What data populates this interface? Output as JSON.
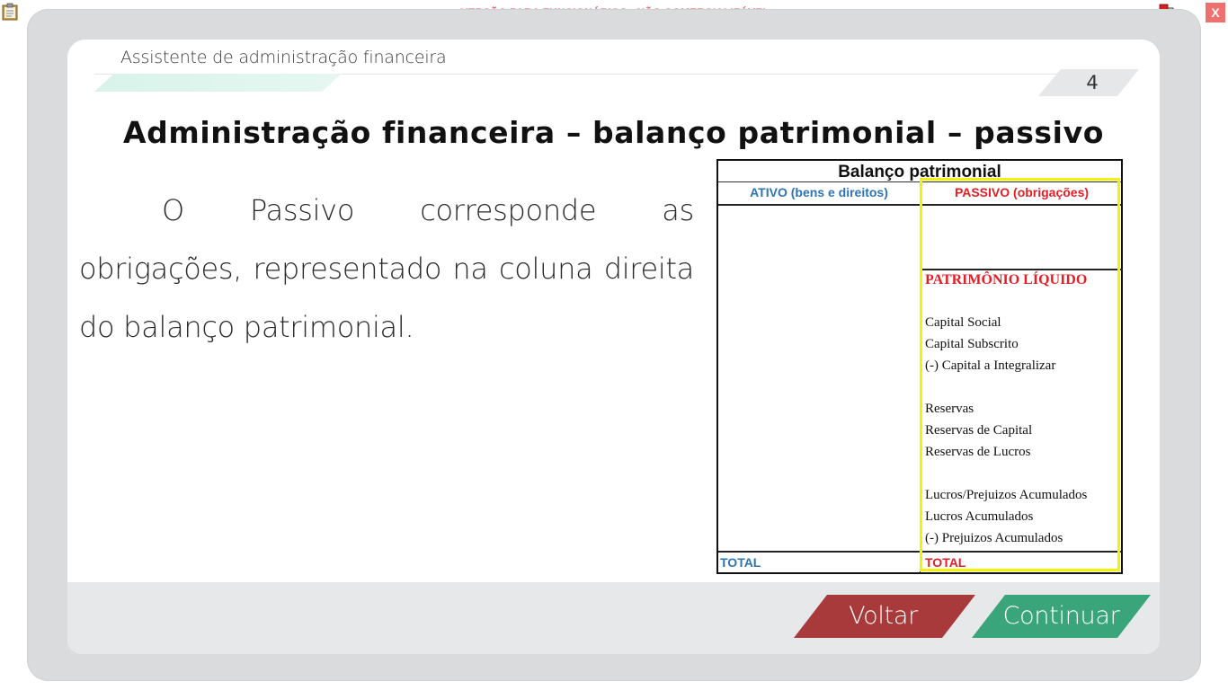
{
  "window": {
    "banner": "VERSÃO PARA FUNCIONÁRIOS - NÃO COMERCIALIZÁVEL",
    "close_label": "X",
    "icons": {
      "clipboard": "clipboard-icon",
      "network": "network-status-icon"
    }
  },
  "header": {
    "course_title": "Assistente de administração financeira",
    "page_number": "4"
  },
  "slide": {
    "title": "Administração financeira – balanço patrimonial – passivo",
    "body": "O Passivo corresponde as obrigações, representado na coluna direita do balanço patrimonial."
  },
  "balance_sheet": {
    "title": "Balanço patrimonial",
    "col_ativo": "ATIVO (bens e direitos)",
    "col_passivo": "PASSIVO (obrigações)",
    "pl_heading": "PATRIMÔNIO LÍQUIDO",
    "items": [
      "Capital Social",
      "Capital Subscrito",
      "(-) Capital a Integralizar",
      "Reservas",
      "Reservas de Capital",
      "Reservas de Lucros",
      "Lucros/Prejuizos Acumulados",
      "Lucros Acumulados",
      "(-) Prejuizos Acumulados"
    ],
    "total_ativo": "TOTAL",
    "total_passivo": "TOTAL"
  },
  "navigation": {
    "back_label": "Voltar",
    "continue_label": "Continuar"
  },
  "colors": {
    "banner_text": "#e8434a",
    "ativo_blue": "#2e74b5",
    "passivo_red": "#e41e26",
    "highlight_yellow": "#f5f20a",
    "back_button": "#a83a3c",
    "continue_button": "#3aa57a",
    "accent_mint": "#d8f3ea"
  }
}
